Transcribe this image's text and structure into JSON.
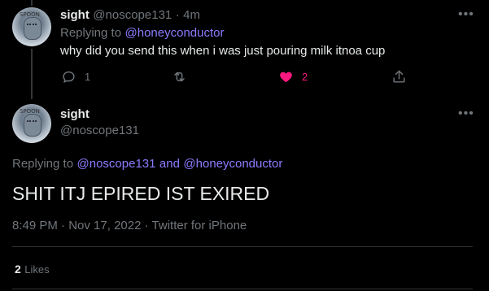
{
  "reply_tweet": {
    "display_name": "sight",
    "handle": "@noscope131",
    "separator": "·",
    "time": "4m",
    "replying_prefix": "Replying to",
    "replying_to": "@honeyconductor",
    "text": "why did you send this when i was just pouring milk itnoa cup",
    "reply_count": "1",
    "like_count": "2",
    "liked": true,
    "more": "•••"
  },
  "main_tweet": {
    "display_name": "sight",
    "handle": "@noscope131",
    "more": "•••",
    "replying_prefix": "Replying to",
    "replying_user1": "@noscope131",
    "replying_and": "and",
    "replying_user2": "@honeyconductor",
    "text": "SHIT ITJ EPIRED IST EXIRED",
    "time": "8:49 PM",
    "sep1": "·",
    "date": "Nov 17, 2022",
    "sep2": "·",
    "source": "Twitter for iPhone",
    "likes_count": "2",
    "likes_label": "Likes"
  },
  "avatar_text": "SPOON",
  "colors": {
    "background": "#000000",
    "text": "#e7e9ea",
    "muted": "#71767b",
    "link": "#8b7cff",
    "like": "#f91880",
    "divider": "#2f3336"
  },
  "icons": {
    "reply": "reply-icon",
    "retweet": "retweet-icon",
    "like": "heart-icon",
    "share": "share-icon",
    "more": "more-icon"
  }
}
